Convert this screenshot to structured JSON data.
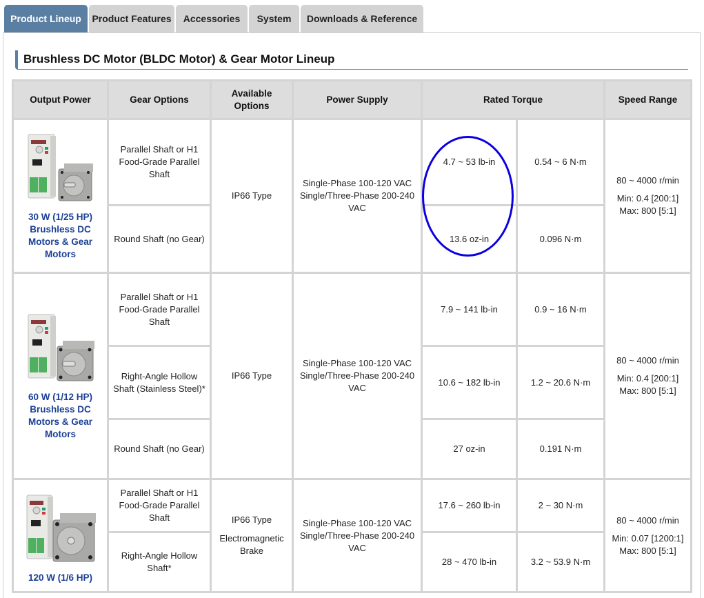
{
  "tabs": [
    {
      "label": "Product Lineup",
      "active": true
    },
    {
      "label": "Product Features",
      "active": false
    },
    {
      "label": "Accessories",
      "active": false
    },
    {
      "label": "System",
      "active": false
    },
    {
      "label": "Downloads & Reference",
      "active": false
    }
  ],
  "section_title": "Brushless DC Motor (BLDC Motor) & Gear Motor Lineup",
  "table": {
    "headers": {
      "output_power": "Output Power",
      "gear_options": "Gear Options",
      "available_options": "Available Options",
      "power_supply": "Power Supply",
      "rated_torque": "Rated Torque",
      "speed_range": "Speed Range"
    },
    "groups": [
      {
        "power_link": "30 W (1/25 HP) Brushless DC Motors & Gear Motors",
        "image": "bldc-motor-driver-30w-image",
        "available_options": [
          "IP66 Type"
        ],
        "power_supply": "Single-Phase 100-120 VAC Single/Three-Phase 200-240 VAC",
        "speed_main": "80 ~ 4000 r/min",
        "speed_min": "Min: 0.4 [200:1]",
        "speed_max": "Max: 800 [5:1]",
        "rows": [
          {
            "gear": "Parallel Shaft or H1 Food-Grade Parallel Shaft",
            "torque_imperial": "4.7 ~ 53 lb-in",
            "torque_metric": "0.54 ~ 6 N·m"
          },
          {
            "gear": "Round Shaft (no Gear)",
            "torque_imperial": "13.6 oz-in",
            "torque_metric": "0.096 N·m"
          }
        ]
      },
      {
        "power_link": "60 W (1/12 HP) Brushless DC Motors & Gear Motors",
        "image": "bldc-motor-driver-60w-image",
        "available_options": [
          "IP66 Type"
        ],
        "power_supply": "Single-Phase 100-120 VAC Single/Three-Phase 200-240 VAC",
        "speed_main": "80 ~ 4000 r/min",
        "speed_min": "Min: 0.4 [200:1]",
        "speed_max": "Max: 800 [5:1]",
        "rows": [
          {
            "gear": "Parallel Shaft or H1 Food-Grade Parallel Shaft",
            "torque_imperial": "7.9 ~ 141 lb-in",
            "torque_metric": "0.9 ~ 16 N·m"
          },
          {
            "gear": "Right-Angle Hollow Shaft (Stainless Steel)*",
            "torque_imperial": "10.6 ~ 182 lb-in",
            "torque_metric": "1.2 ~ 20.6 N·m"
          },
          {
            "gear": "Round Shaft (no Gear)",
            "torque_imperial": "27 oz-in",
            "torque_metric": "0.191 N·m"
          }
        ]
      },
      {
        "power_link": "120 W (1/6 HP)",
        "image": "bldc-motor-driver-120w-image",
        "available_options": [
          "IP66 Type",
          "Electromagnetic Brake"
        ],
        "power_supply": "Single-Phase 100-120 VAC Single/Three-Phase 200-240 VAC",
        "speed_main": "80 ~ 4000 r/min",
        "speed_min": "Min: 0.07 [1200:1]",
        "speed_max": "Max: 800 [5:1]",
        "rows": [
          {
            "gear": "Parallel Shaft or H1 Food-Grade Parallel Shaft",
            "torque_imperial": "17.6 ~ 260 lb-in",
            "torque_metric": "2 ~ 30 N·m"
          },
          {
            "gear": "Right-Angle Hollow Shaft*",
            "torque_imperial": "28 ~ 470 lb-in",
            "torque_metric": "3.2 ~ 53.9 N·m"
          }
        ]
      }
    ]
  },
  "annotation": {
    "shape": "ellipse",
    "color": "#0b00e0",
    "target": "30W rated torque lb-in / oz-in column"
  },
  "colors": {
    "active_tab": "#5b7fa3",
    "inactive_tab": "#d3d3d3",
    "link": "#1a3f95",
    "header_bg": "#dddddd",
    "border": "#d4d4d4"
  }
}
